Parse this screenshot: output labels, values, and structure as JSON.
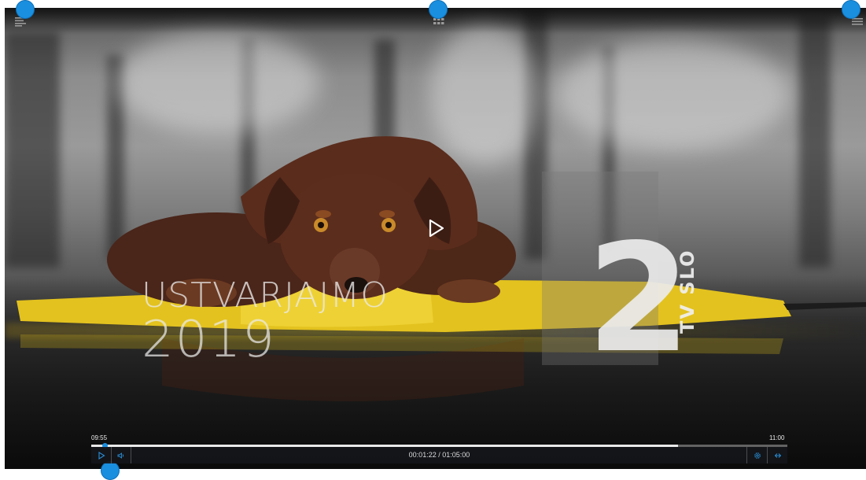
{
  "title_overlay": {
    "line1": "USTVARJAJMO",
    "line2": "2019"
  },
  "channel_logo": {
    "number": "2",
    "text": "TV SLO"
  },
  "top_toolbar": {
    "left_icon": "playlist-icon",
    "center_icon": "grid-icon",
    "right_icon": "menu-icon"
  },
  "player": {
    "start_time": "09:55",
    "end_time": "11:00",
    "elapsed": "00:01:22",
    "separator": "/",
    "duration": "01:05:00",
    "buffered_fraction": 0.843,
    "played_fraction": 0.02,
    "buttons": {
      "play": "play-icon",
      "volume": "volume-icon",
      "settings": "settings-icon",
      "fullscreen": "fullscreen-icon"
    }
  },
  "colors": {
    "accent": "#1a8fe0",
    "controlbar_bg": "#14161a",
    "umbrella_yellow": "#e3c21f"
  }
}
